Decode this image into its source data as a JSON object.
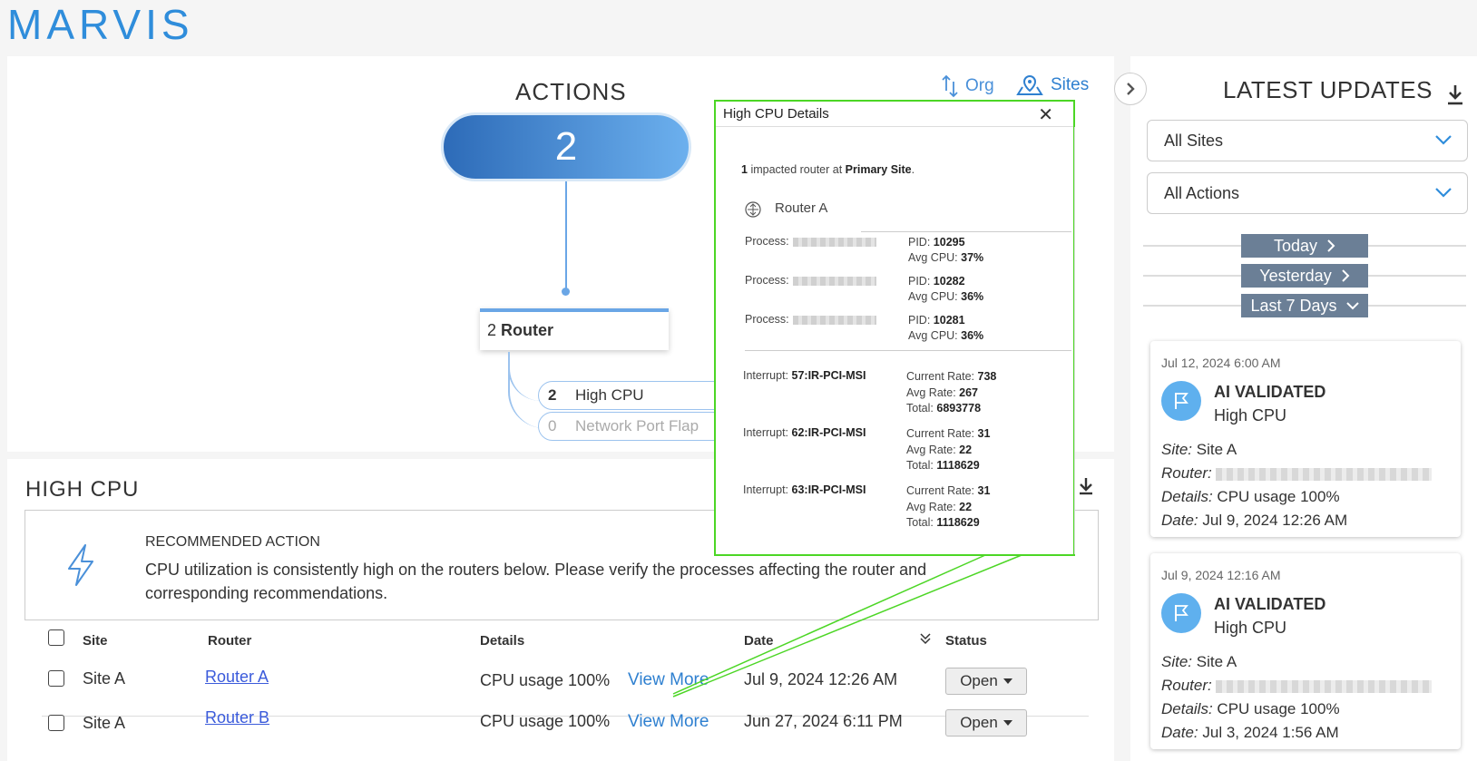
{
  "brand": "MARVIS",
  "actions": {
    "title": "ACTIONS",
    "total": "2",
    "org_label": "Org",
    "sites_label": "Sites",
    "category_count": "2",
    "category_label": "Router",
    "items": [
      {
        "count": "2",
        "label": "High CPU"
      },
      {
        "count": "0",
        "label": "Network Port Flap"
      }
    ]
  },
  "popup": {
    "title": "High CPU Details",
    "summary_count": "1",
    "summary_text": "impacted router at",
    "summary_site": "Primary Site",
    "router_name": "Router A",
    "process_label": "Process:",
    "pid_label": "PID:",
    "avg_cpu_label": "Avg CPU:",
    "processes": [
      {
        "pid": "10295",
        "avg_cpu": "37%"
      },
      {
        "pid": "10282",
        "avg_cpu": "36%"
      },
      {
        "pid": "10281",
        "avg_cpu": "36%"
      }
    ],
    "interrupt_label": "Interrupt:",
    "current_rate_label": "Current Rate:",
    "avg_rate_label": "Avg Rate:",
    "total_label": "Total:",
    "interrupts": [
      {
        "name": "57:IR-PCI-MSI",
        "current_rate": "738",
        "avg_rate": "267",
        "total": "6893778"
      },
      {
        "name": "62:IR-PCI-MSI",
        "current_rate": "31",
        "avg_rate": "22",
        "total": "1118629"
      },
      {
        "name": "63:IR-PCI-MSI",
        "current_rate": "31",
        "avg_rate": "22",
        "total": "1118629"
      }
    ]
  },
  "highcpu": {
    "title": "HIGH CPU",
    "rec_head": "RECOMMENDED ACTION",
    "rec_text": "CPU utilization is consistently high on the routers below. Please verify the processes affecting the router and corresponding recommendations.",
    "columns": {
      "site": "Site",
      "router": "Router",
      "details": "Details",
      "date": "Date",
      "status": "Status"
    },
    "rows": [
      {
        "site": "Site A",
        "router": "Router A",
        "details": "CPU usage 100%",
        "view_more": "View More",
        "date": "Jul 9, 2024 12:26 AM",
        "status": "Open"
      },
      {
        "site": "Site A",
        "router": "Router B",
        "details": "CPU usage 100%",
        "view_more": "View More",
        "date": "Jun 27, 2024 6:11 PM",
        "status": "Open"
      }
    ]
  },
  "updates": {
    "title": "LATEST UPDATES",
    "site_filter": "All Sites",
    "action_filter": "All Actions",
    "day_groups": [
      "Today",
      "Yesterday",
      "Last 7 Days"
    ],
    "labels": {
      "site": "Site:",
      "router": "Router:",
      "details": "Details:",
      "date": "Date:"
    },
    "cards": [
      {
        "timestamp": "Jul 12, 2024 6:00 AM",
        "status": "AI VALIDATED",
        "type": "High CPU",
        "site": "Site A",
        "details": "CPU usage 100%",
        "date": "Jul 9, 2024 12:26 AM"
      },
      {
        "timestamp": "Jul 9, 2024 12:16 AM",
        "status": "AI VALIDATED",
        "type": "High CPU",
        "site": "Site A",
        "details": "CPU usage 100%",
        "date": "Jul 3, 2024 1:56 AM"
      }
    ]
  },
  "colors": {
    "accent": "#2f8ddb",
    "callout": "#4cd625",
    "day_button": "#6b7f96",
    "validated_icon": "#5fb0ee"
  }
}
